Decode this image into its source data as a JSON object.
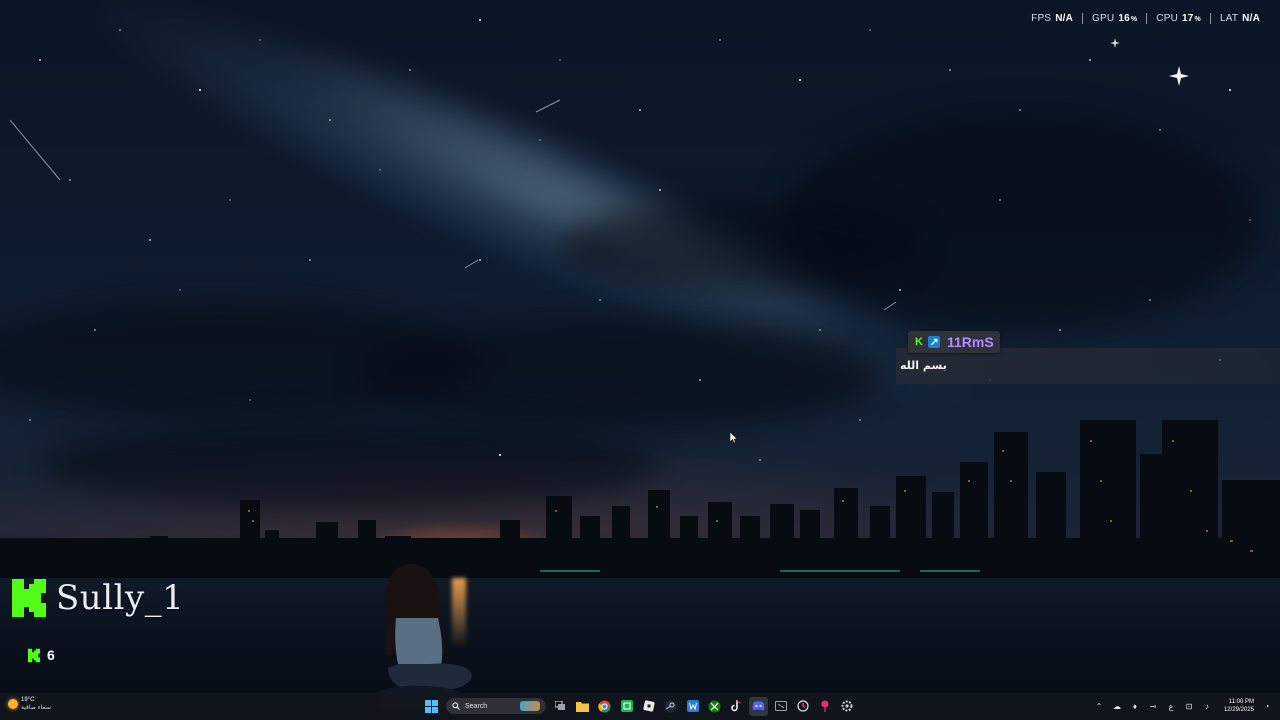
{
  "perf_overlay": {
    "fps_label": "FPS",
    "fps_value": "N/A",
    "gpu_label": "GPU",
    "gpu_value": "16",
    "gpu_unit": "%",
    "cpu_label": "CPU",
    "cpu_value": "17",
    "cpu_unit": "%",
    "lat_label": "LAT",
    "lat_value": "N/A"
  },
  "chat": {
    "username": "11RmS",
    "message": "بسم الله",
    "name_color": "#b28cff"
  },
  "stream": {
    "streamer_name": "Sully_1",
    "viewer_count": "6",
    "brand_color": "#53fc18"
  },
  "taskbar": {
    "weather_temp": "19°C",
    "weather_condition": "سماء صافية",
    "search_placeholder": "Search",
    "pinned_icons": [
      "windows-start-icon",
      "search",
      "task-view-icon",
      "file-explorer-icon",
      "chrome-icon",
      "spreadsheet-icon",
      "roblox-icon",
      "steam-icon",
      "word-icon",
      "xbox-icon",
      "tiktok-icon",
      "discord-icon",
      "capture-icon",
      "update-icon",
      "pin-icon",
      "settings-icon"
    ],
    "tray_lang": "ع",
    "clock_time": "11:00 PM",
    "clock_date": "12/29/2025"
  }
}
